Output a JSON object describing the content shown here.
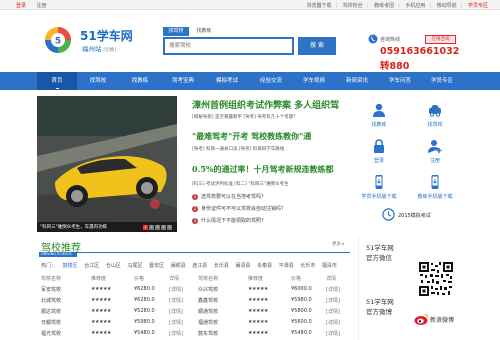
{
  "topbar": {
    "login": "登录",
    "register": "注册",
    "links": [
      "浏览器下载",
      "驾校粉丝",
      "教练考团",
      "手机应用",
      "移动导航"
    ],
    "highlight": "学员专区"
  },
  "brand": {
    "name": "51学车网",
    "station": "福州站",
    "switch": "[切换]",
    "logo_colors": [
      "#e94e3c",
      "#f6b42a",
      "#4caf50",
      "#2c72c9"
    ]
  },
  "search": {
    "tab_active": "找驾校",
    "tab_inactive": "找教练",
    "placeholder": "搜索驾校",
    "button": "搜 索"
  },
  "contact": {
    "label": "咨询热线",
    "badge": "在线咨询",
    "phone1": "0591636610​32",
    "phone2": "转880"
  },
  "nav": {
    "items": [
      "首页",
      "找驾校",
      "找教练",
      "驾考宝典",
      "模拟考试",
      "经验交流",
      "学车视频",
      "新闻资讯",
      "学车问答",
      "学员专区"
    ],
    "active": 0
  },
  "slider": {
    "caption": "\"科目三\"难倒众考生，车遇内功练",
    "dots": [
      "1",
      "2",
      "3",
      "4",
      "5"
    ],
    "active_dot": 0
  },
  "news": [
    {
      "title": "漳州首例组织考试作弊案 多人组织驾",
      "sub": "[揭秘驾校] 是否暴露和平  [驾考] 驾考有几十个考题？"
    },
    {
      "title": "\"最难驾考\"开考  驾校教练教你\"通",
      "sub": "[驾考] 科目一通关口诀  [驾考] 科目四学车路线"
    },
    {
      "title": "0.5%的通过率！十月驾考新规连教练都",
      "sub": "[科三] 考试评判标准  [科二] \"科目三\"难倒众考生"
    }
  ],
  "questions": [
    {
      "n": "1",
      "text": "选驾校要可以在当地考驾吗？"
    },
    {
      "n": "2",
      "text": "身份证件可不可以驾校会自动注销吗？"
    },
    {
      "n": "3",
      "text": "什么情况下不能领取的驾照？"
    }
  ],
  "quicklinks": [
    {
      "label": "找教练",
      "icon": "coach-icon"
    },
    {
      "label": "找驾校",
      "icon": "school-icon"
    },
    {
      "label": "登录",
      "icon": "login-icon"
    },
    {
      "label": "注册",
      "icon": "register-icon"
    },
    {
      "label": "学员手机版下载",
      "icon": "mobile-icon"
    },
    {
      "label": "教练手机版下载",
      "icon": "coach-app-icon"
    }
  ],
  "exam_link": "2015模拟考试",
  "section": {
    "title": "驾校推荐",
    "tag": "DRIVING SCHOOL",
    "more": "更多 ▸",
    "tags_label": "热门：",
    "tags": [
      "鼓楼区",
      "台江区",
      "仓山区",
      "马尾区",
      "晋安区",
      "闽侯县",
      "连江县",
      "长乐县",
      "闽清县",
      "永泰县",
      "平潭县",
      "长乐市",
      "福清市"
    ]
  },
  "tables": {
    "headers": [
      "驾校名称",
      "推荐度",
      "价格",
      "详情"
    ],
    "left": [
      {
        "name": "军安驾校",
        "stars": 5,
        "price": "¥6280.0",
        "detail": "[详情]"
      },
      {
        "name": "北城驾校",
        "stars": 5,
        "price": "¥6280.0",
        "detail": "[详情]"
      },
      {
        "name": "顺达驾校",
        "stars": 5,
        "price": "¥5280.0",
        "detail": "[详情]"
      },
      {
        "name": "日都驾校",
        "stars": 5,
        "price": "¥5980.0",
        "detail": "[详情]"
      },
      {
        "name": "福光驾校",
        "stars": 5,
        "price": "¥5480.0",
        "detail": "[详情]"
      }
    ],
    "right": [
      {
        "name": "众兴驾校",
        "stars": 5,
        "price": "¥6000.0",
        "detail": "[详情]"
      },
      {
        "name": "鑫鑫驾校",
        "stars": 5,
        "price": "¥5980.0",
        "detail": "[详情]"
      },
      {
        "name": "顺通驾校",
        "stars": 5,
        "price": "¥5800.0",
        "detail": "[详情]"
      },
      {
        "name": "福通驾校",
        "stars": 5,
        "price": "¥5600.0",
        "detail": "[详情]"
      },
      {
        "name": "鼓东驾校",
        "stars": 5,
        "price": "¥5480.0",
        "detail": "[详情]"
      }
    ]
  },
  "sidebar": {
    "block1": [
      "51学车网",
      "官方微信"
    ],
    "block2": [
      "51学车网",
      "官方微博"
    ],
    "weibo": "新浪微博"
  }
}
